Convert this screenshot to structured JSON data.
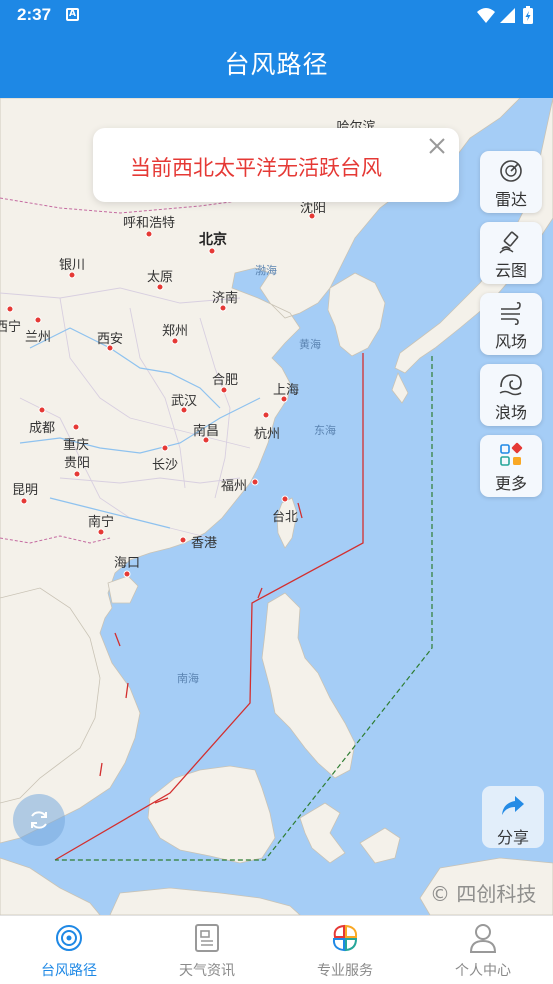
{
  "status_bar": {
    "time": "2:37",
    "notification_icon": "A"
  },
  "title": "台风路径",
  "alert": {
    "message": "当前西北太平洋无活跃台风"
  },
  "side_buttons": [
    {
      "label": "雷达",
      "icon": "radar-icon"
    },
    {
      "label": "云图",
      "icon": "satellite-icon"
    },
    {
      "label": "风场",
      "icon": "wind-icon"
    },
    {
      "label": "浪场",
      "icon": "wave-icon"
    },
    {
      "label": "更多",
      "icon": "more-grid-icon"
    }
  ],
  "share_label": "分享",
  "watermark": "© 四创科技",
  "map": {
    "cities": [
      "哈尔滨",
      "沈阳",
      "呼和浩特",
      "北京",
      "银川",
      "太原",
      "济南",
      "西宁",
      "兰州",
      "西安",
      "郑州",
      "合肥",
      "上海",
      "武汉",
      "南昌",
      "杭州",
      "成都",
      "重庆",
      "贵阳",
      "长沙",
      "福州",
      "台北",
      "昆明",
      "南宁",
      "香港",
      "海口"
    ],
    "seas": [
      "渤海",
      "黄海",
      "东海",
      "南海"
    ]
  },
  "tabs": [
    {
      "label": "台风路径",
      "icon": "typhoon-icon",
      "active": true
    },
    {
      "label": "天气资讯",
      "icon": "news-icon",
      "active": false
    },
    {
      "label": "专业服务",
      "icon": "service-icon",
      "active": false
    },
    {
      "label": "个人中心",
      "icon": "person-icon",
      "active": false
    }
  ],
  "colors": {
    "primary": "#1e88e5",
    "alert": "#e53935",
    "warning_line_24h": "#d32f2f",
    "warning_line_48h": "#2e7d32"
  }
}
